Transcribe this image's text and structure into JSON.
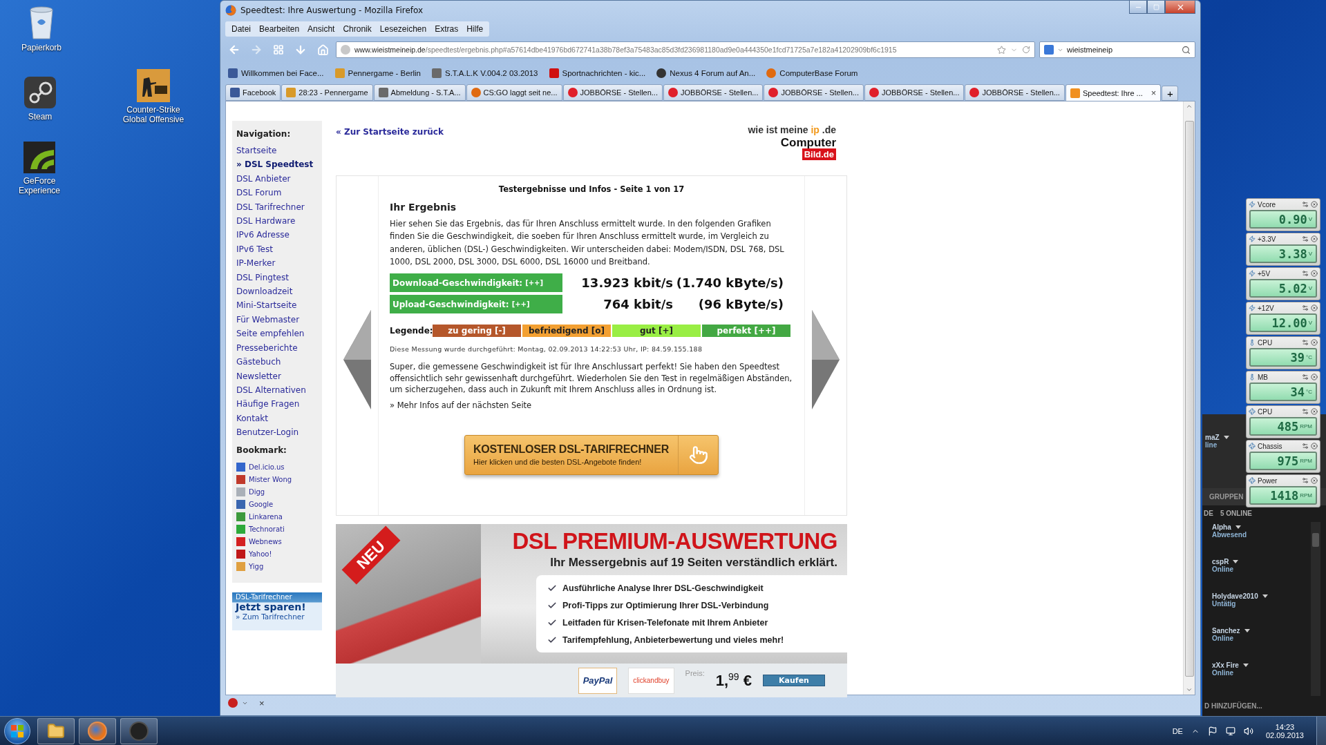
{
  "desktop_icons": [
    {
      "label": "Papierkorb",
      "kind": "trash"
    },
    {
      "label": "Steam",
      "kind": "steam"
    },
    {
      "label": "GeForce Experience",
      "kind": "geforce"
    },
    {
      "label": "Counter-Strike Global Offensive",
      "kind": "csgo"
    }
  ],
  "browser": {
    "title": "Speedtest: Ihre Auswertung - Mozilla Firefox",
    "menu": [
      "Datei",
      "Bearbeiten",
      "Ansicht",
      "Chronik",
      "Lesezeichen",
      "Extras",
      "Hilfe"
    ],
    "url": {
      "host": "www.wieistmeineip.de",
      "path": "/speedtest/ergebnis.php#a57614dbe41976bd672741a38b78ef3a75483ac85d3fd236981180ad9e0a444350e1fcd71725a7e182a41202909bf6c1915"
    },
    "search": {
      "value": "wieistmeineip"
    },
    "bookmarks_bar": [
      {
        "label": "Willkommen bei Face...",
        "kind": "facebook"
      },
      {
        "label": "Pennergame - Berlin",
        "kind": "pennergame"
      },
      {
        "label": "S.T.A.L.K V.004.2 03.2013",
        "kind": "stalk"
      },
      {
        "label": "Sportnachrichten - kic...",
        "kind": "kicker"
      },
      {
        "label": "Nexus 4 Forum auf An...",
        "kind": "android"
      },
      {
        "label": "ComputerBase Forum",
        "kind": "computerbase"
      }
    ],
    "tabs": [
      {
        "label": "Facebook",
        "kind": "facebook",
        "selected": false
      },
      {
        "label": "28:23 - Pennergame",
        "kind": "pennergame",
        "selected": false
      },
      {
        "label": "Abmeldung - S.T.A...",
        "kind": "stalk",
        "selected": false
      },
      {
        "label": "CS:GO laggt seit ne...",
        "kind": "computerbase",
        "selected": false
      },
      {
        "label": "JOBBÖRSE - Stellen...",
        "kind": "jobboerse",
        "selected": false
      },
      {
        "label": "JOBBÖRSE - Stellen...",
        "kind": "jobboerse",
        "selected": false
      },
      {
        "label": "JOBBÖRSE - Stellen...",
        "kind": "jobboerse",
        "selected": false
      },
      {
        "label": "JOBBÖRSE - Stellen...",
        "kind": "jobboerse",
        "selected": false
      },
      {
        "label": "JOBBÖRSE - Stellen...",
        "kind": "jobboerse",
        "selected": false
      },
      {
        "label": "Speedtest: Ihre ...",
        "kind": "speedtest",
        "selected": true
      }
    ],
    "tab_close": "×",
    "new_tab": "+",
    "addon_close": "×"
  },
  "page": {
    "back_link": "« Zur Startseite zurück",
    "site_logo": {
      "text": "wie ist meine",
      "highlight": "ip",
      "suffix": ".de"
    },
    "partner_logo": {
      "text": "Computer",
      "badge": "Bild.de"
    },
    "navigation": {
      "heading": "Navigation:",
      "items": [
        {
          "label": "Startseite",
          "selected": false
        },
        {
          "label": "» DSL Speedtest",
          "selected": true
        },
        {
          "label": "DSL Anbieter",
          "selected": false
        },
        {
          "label": "DSL Forum",
          "selected": false
        },
        {
          "label": "DSL Tarifrechner",
          "selected": false
        },
        {
          "label": "DSL Hardware",
          "selected": false
        },
        {
          "label": "IPv6 Adresse",
          "selected": false
        },
        {
          "label": "IPv6 Test",
          "selected": false
        },
        {
          "label": "IP-Merker",
          "selected": false
        },
        {
          "label": "DSL Pingtest",
          "selected": false
        },
        {
          "label": "Downloadzeit",
          "selected": false
        },
        {
          "label": "Mini-Startseite",
          "selected": false
        },
        {
          "label": "Für Webmaster",
          "selected": false
        },
        {
          "label": "Seite empfehlen",
          "selected": false
        },
        {
          "label": "Presseberichte",
          "selected": false
        },
        {
          "label": "Gästebuch",
          "selected": false
        },
        {
          "label": "Newsletter",
          "selected": false
        },
        {
          "label": "DSL Alternativen",
          "selected": false
        },
        {
          "label": "Häufige Fragen",
          "selected": false
        },
        {
          "label": "Kontakt",
          "selected": false
        },
        {
          "label": "Benutzer-Login",
          "selected": false
        }
      ]
    },
    "bookmark": {
      "heading": "Bookmark:",
      "items": [
        {
          "label": "Del.icio.us",
          "color": "#3366cc"
        },
        {
          "label": "Mister Wong",
          "color": "#c0392b"
        },
        {
          "label": "Digg",
          "color": "#aab0b8"
        },
        {
          "label": "Google",
          "color": "#3a66b0"
        },
        {
          "label": "Linkarena",
          "color": "#3d9a3d"
        },
        {
          "label": "Technorati",
          "color": "#2eaa3a"
        },
        {
          "label": "Webnews",
          "color": "#d42020"
        },
        {
          "label": "Yahoo!",
          "color": "#c01818"
        },
        {
          "label": "Yigg",
          "color": "#e0a040"
        }
      ]
    },
    "promo": {
      "title": "DSL-Tarifrechner",
      "headline": "Jetzt sparen!",
      "link": "» Zum Tarifrechner"
    },
    "result": {
      "title": "Testergebnisse und Infos - Seite 1 von 17",
      "heading": "Ihr Ergebnis",
      "intro": "Hier sehen Sie das Ergebnis, das für Ihren Anschluss ermittelt wurde. In den folgenden Grafiken finden Sie die Geschwindigkeit, die soeben für Ihren Anschluss ermittelt wurde, im Vergleich zu anderen, üblichen (DSL-) Geschwindigkeiten. Wir unterscheiden dabei: Modem/ISDN, DSL 768, DSL 1000, DSL 2000, DSL 3000, DSL 6000, DSL 16000 und Breitband.",
      "speeds": [
        {
          "label": "Download-Geschwindigkeit:",
          "rating": "[++]",
          "kbit": "13.923 kbit/s",
          "kbyte": "(1.740 kByte/s)"
        },
        {
          "label": "Upload-Geschwindigkeit:",
          "rating": "[++]",
          "kbit": "764 kbit/s",
          "kbyte": "(96 kByte/s)"
        }
      ],
      "legend": {
        "label": "Legende:",
        "items": [
          {
            "label": "zu gering [-]",
            "color": "#b5572b"
          },
          {
            "label": "befriedigend [o]",
            "color": "#f3a032"
          },
          {
            "label": "gut [+]",
            "color": "#99ee44"
          },
          {
            "label": "perfekt [++]",
            "color": "#43a843"
          }
        ]
      },
      "measurement": "Diese Messung wurde durchgeführt: Montag, 02.09.2013 14:22:53 Uhr, IP: 84.59.155.188",
      "verdict": "Super, die gemessene Geschwindigkeit ist für Ihre Anschlussart perfekt! Sie haben den Speedtest offensichtlich sehr gewissenhaft durchgeführt. Wiederholen Sie den Test in regelmäßigen Abständen, um sicherzugehen, dass auch in Zukunft mit Ihrem Anschluss alles in Ordnung ist.",
      "more_link": "» Mehr Infos auf der nächsten Seite",
      "cta": {
        "title": "KOSTENLOSER DSL-TARIFRECHNER",
        "subtitle": "Hier klicken und die besten DSL-Angebote finden!"
      }
    },
    "banner": {
      "ribbon": "NEU",
      "heading": "DSL PREMIUM-AUSWERTUNG",
      "subheading": "Ihr Messergebnis auf 19 Seiten verständlich erklärt.",
      "features": [
        "Ausführliche Analyse Ihrer DSL-Geschwindigkeit",
        "Profi-Tipps zur Optimierung Ihrer DSL-Verbindung",
        "Leitfaden für Krisen-Telefonate mit Ihrem Anbieter",
        "Tarifempfehlung, Anbieterbewertung und vieles mehr!"
      ],
      "payment_logos": [
        "PayPal",
        "clickandbuy"
      ],
      "price_label": "Preis:",
      "price": "1,$^{99}$ €",
      "buy": "Kaufen"
    }
  },
  "gadgets": [
    {
      "label": "Vcore",
      "kind": "voltage",
      "value": "0.90",
      "unit": "V"
    },
    {
      "label": "+3.3V",
      "kind": "voltage",
      "value": "3.38",
      "unit": "V"
    },
    {
      "label": "+5V",
      "kind": "voltage",
      "value": "5.02",
      "unit": "V"
    },
    {
      "label": "+12V",
      "kind": "voltage",
      "value": "12.00",
      "unit": "V"
    },
    {
      "label": "CPU",
      "kind": "temperature",
      "value": "39",
      "unit": "°C"
    },
    {
      "label": "MB",
      "kind": "temperature",
      "value": "34",
      "unit": "°C"
    },
    {
      "label": "CPU",
      "kind": "fan",
      "value": "485",
      "unit": "RPM"
    },
    {
      "label": "Chassis",
      "kind": "fan",
      "value": "975",
      "unit": "RPM"
    },
    {
      "label": "Power",
      "kind": "fan",
      "value": "1418",
      "unit": "RPM"
    }
  ],
  "steam": {
    "profile_name": "maZ",
    "profile_status": "line",
    "tab": "GRUPPEN",
    "list_header": "DE",
    "online_count": "5 ONLINE",
    "friends": [
      {
        "name": "Alpha",
        "status": "Abwesend"
      },
      {
        "name": "cspR",
        "status": "Online"
      },
      {
        "name": "Holydave2010",
        "status": "Untätig"
      },
      {
        "name": "Sanchez",
        "status": "Online"
      },
      {
        "name": "xXx Fire",
        "status": "Online"
      }
    ],
    "footer": "D HINZUFÜGEN..."
  },
  "taskbar": {
    "apps": [
      {
        "kind": "explorer"
      },
      {
        "kind": "firefox"
      },
      {
        "kind": "steam"
      }
    ],
    "language": "DE",
    "time": "14:23",
    "date": "02.09.2013"
  }
}
